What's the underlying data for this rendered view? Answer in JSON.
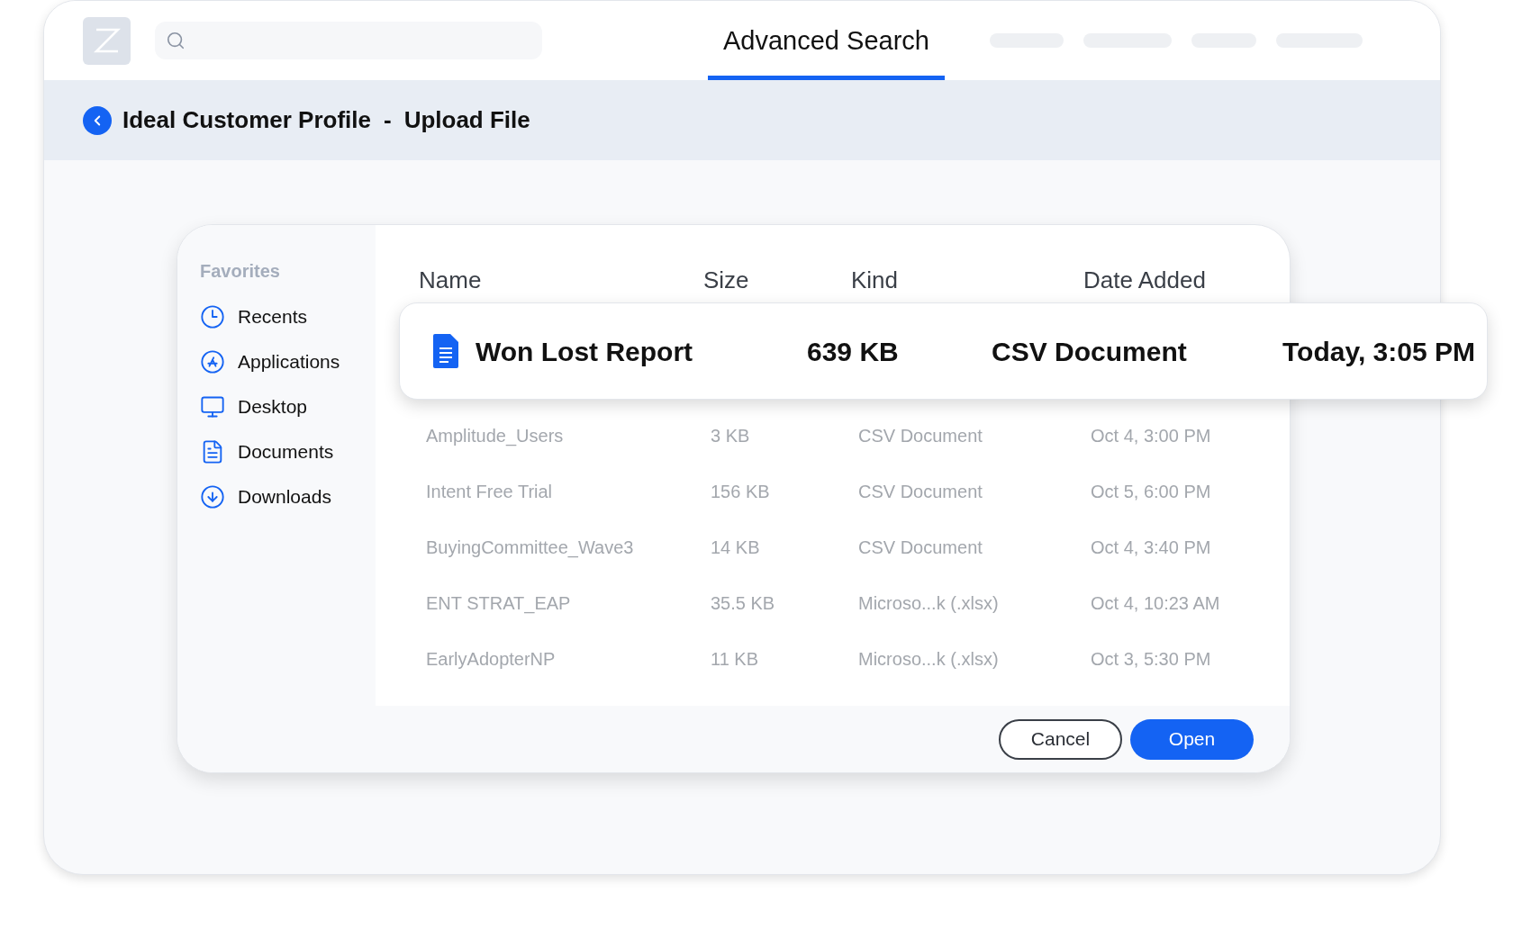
{
  "tabs": [
    {
      "label": "Advanced Search",
      "selected": true
    }
  ],
  "breadcrumb": {
    "title": "Ideal Customer Profile",
    "separator": "-",
    "page": "Upload File"
  },
  "sidebar": {
    "heading": "Favorites",
    "items": [
      {
        "label": "Recents",
        "kind": "clock"
      },
      {
        "label": "Applications",
        "kind": "apps"
      },
      {
        "label": "Desktop",
        "kind": "desktop"
      },
      {
        "label": "Documents",
        "kind": "document"
      },
      {
        "label": "Downloads",
        "kind": "download"
      }
    ]
  },
  "table": {
    "columns": [
      "Name",
      "Size",
      "Kind",
      "Date Added"
    ],
    "rows": [
      {
        "name": "Amplitude_Users",
        "size": "3 KB",
        "kind": "CSV Document",
        "date": "Oct 4, 3:00 PM"
      },
      {
        "name": "Intent Free Trial",
        "size": "156 KB",
        "kind": "CSV Document",
        "date": "Oct 5, 6:00 PM"
      },
      {
        "name": "BuyingCommittee_Wave3",
        "size": "14 KB",
        "kind": "CSV Document",
        "date": "Oct 4, 3:40 PM"
      },
      {
        "name": "ENT STRAT_EAP",
        "size": "35.5 KB",
        "kind": "Microso...k (.xlsx)",
        "date": "Oct 4, 10:23 AM"
      },
      {
        "name": "EarlyAdopterNP",
        "size": "11 KB",
        "kind": "Microso...k (.xlsx)",
        "date": "Oct 3, 5:30 PM"
      }
    ]
  },
  "selected_file": {
    "name": "Won Lost Report",
    "size": "639 KB",
    "kind": "CSV Document",
    "date": "Today, 3:05 PM"
  },
  "buttons": [
    {
      "label": "Cancel",
      "kind": "secondary"
    },
    {
      "label": "Open",
      "kind": "primary"
    }
  ]
}
